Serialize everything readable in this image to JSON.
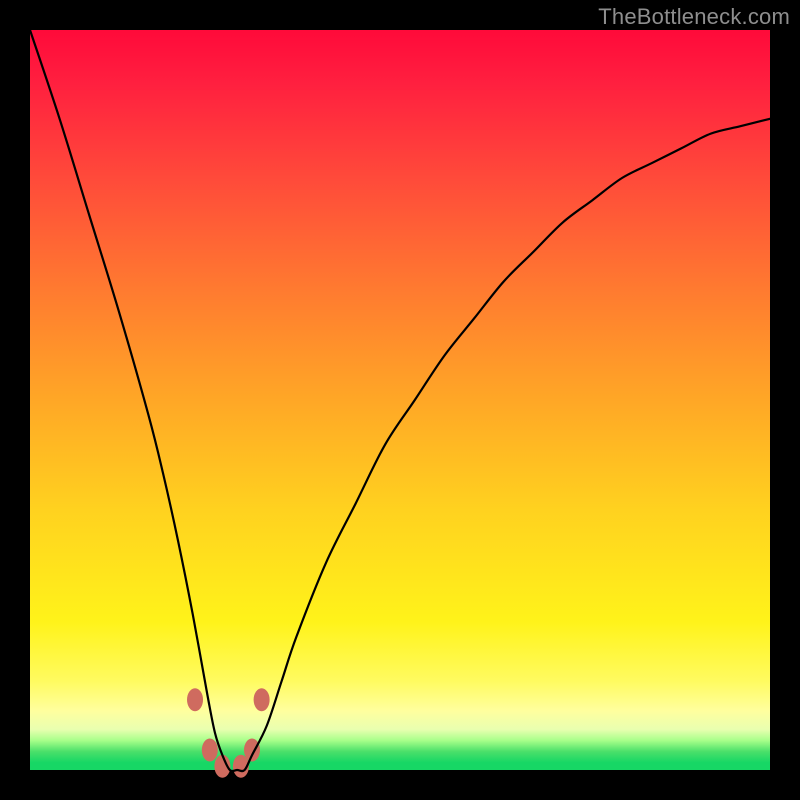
{
  "watermark": "TheBottleneck.com",
  "chart_data": {
    "type": "line",
    "title": "",
    "xlabel": "",
    "ylabel": "",
    "xlim": [
      0,
      100
    ],
    "ylim": [
      0,
      100
    ],
    "x": [
      0,
      4,
      8,
      12,
      16,
      18,
      20,
      22,
      24,
      25,
      26,
      27,
      28,
      29,
      30,
      32,
      34,
      36,
      40,
      44,
      48,
      52,
      56,
      60,
      64,
      68,
      72,
      76,
      80,
      84,
      88,
      92,
      96,
      100
    ],
    "values": [
      100,
      88,
      75,
      62,
      48,
      40,
      31,
      21,
      10,
      5,
      2,
      0,
      0,
      0,
      2,
      6,
      12,
      18,
      28,
      36,
      44,
      50,
      56,
      61,
      66,
      70,
      74,
      77,
      80,
      82,
      84,
      86,
      87,
      88
    ],
    "series": [
      {
        "name": "bottleneck-curve",
        "x": [
          0,
          4,
          8,
          12,
          16,
          18,
          20,
          22,
          24,
          25,
          26,
          27,
          28,
          29,
          30,
          32,
          34,
          36,
          40,
          44,
          48,
          52,
          56,
          60,
          64,
          68,
          72,
          76,
          80,
          84,
          88,
          92,
          96,
          100
        ],
        "y": [
          100,
          88,
          75,
          62,
          48,
          40,
          31,
          21,
          10,
          5,
          2,
          0,
          0,
          0,
          2,
          6,
          12,
          18,
          28,
          36,
          44,
          50,
          56,
          61,
          66,
          70,
          74,
          77,
          80,
          82,
          84,
          86,
          87,
          88
        ]
      }
    ],
    "markers": [
      {
        "x": 22.3,
        "y": 9.5
      },
      {
        "x": 24.3,
        "y": 2.7
      },
      {
        "x": 26.0,
        "y": 0.5
      },
      {
        "x": 28.5,
        "y": 0.5
      },
      {
        "x": 30.0,
        "y": 2.7
      },
      {
        "x": 31.3,
        "y": 9.5
      }
    ],
    "marker_radius_px": 10,
    "marker_color": "#cf6b5f"
  }
}
